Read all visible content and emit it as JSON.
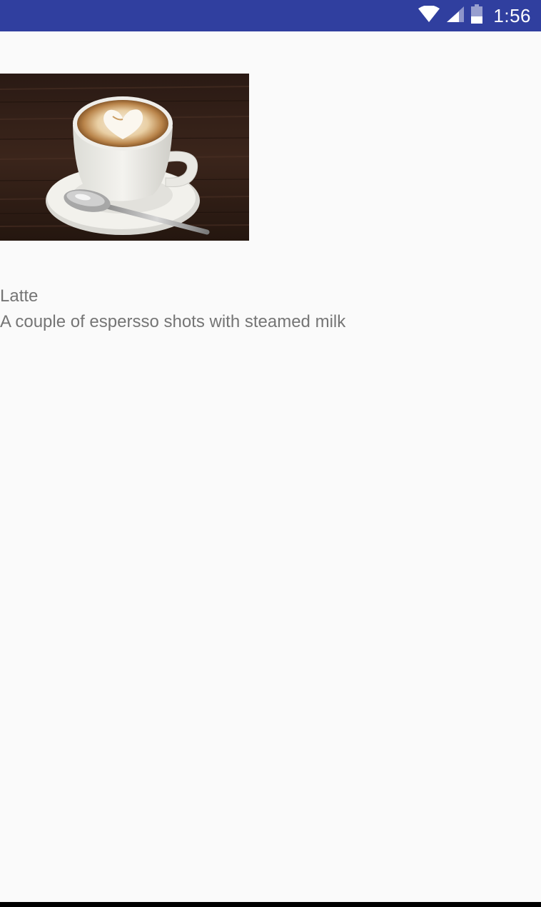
{
  "status_bar": {
    "time": "1:56",
    "background_color": "#303f9f",
    "icons": [
      "wifi-icon",
      "cell-signal-icon",
      "battery-icon"
    ]
  },
  "drink": {
    "name": "Latte",
    "description": "A couple of espersso shots with steamed milk",
    "image_icon": "latte-photo"
  },
  "colors": {
    "text": "#757575",
    "background": "#fafafa"
  }
}
